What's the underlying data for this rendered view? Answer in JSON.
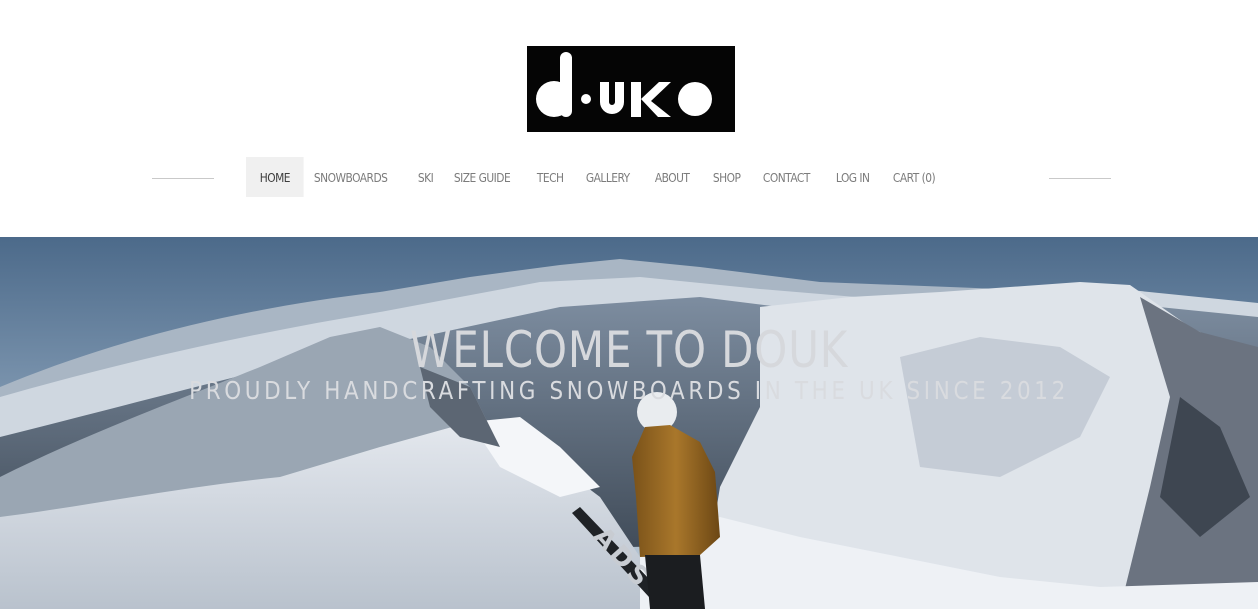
{
  "header": {
    "logo_text": "douko"
  },
  "nav": {
    "items": [
      {
        "label": "HOME"
      },
      {
        "label": "SNOWBOARDS"
      },
      {
        "label": "SKI"
      },
      {
        "label": "SIZE GUIDE"
      },
      {
        "label": "TECH"
      },
      {
        "label": "GALLERY"
      },
      {
        "label": "ABOUT"
      },
      {
        "label": "SHOP"
      },
      {
        "label": "CONTACT"
      },
      {
        "label": "LOG IN"
      },
      {
        "label": "CART (0)"
      }
    ],
    "active": "HOME"
  },
  "hero": {
    "title": "WELCOME TO DOUK",
    "subtitle": "PROUDLY HANDCRAFTING SNOWBOARDS IN THE UK SINCE 2012",
    "board_print": "ADS"
  },
  "colors": {
    "logo_bg": "#050505",
    "nav_active_bg": "#f0f0f0",
    "nav_text": "#7c7c7c",
    "hero_text": "#d6d8dc",
    "sky": "#5f7b98",
    "snow": "#eef0f3",
    "jacket": "#9a6a22"
  }
}
